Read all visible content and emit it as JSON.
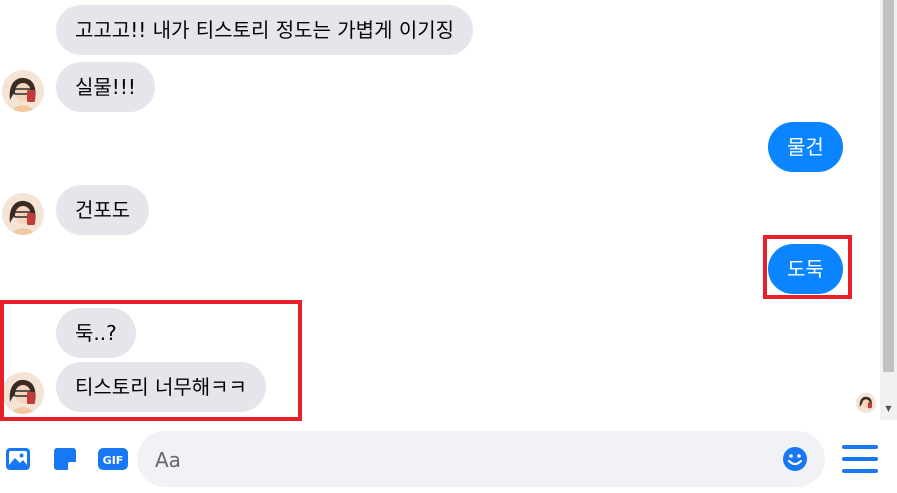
{
  "messages": [
    {
      "direction": "incoming",
      "text": "고고고!! 내가 티스토리 정도는 가볍게 이기징"
    },
    {
      "direction": "incoming",
      "text": "실물!!!"
    },
    {
      "direction": "outgoing",
      "text": "물건"
    },
    {
      "direction": "incoming",
      "text": "건포도"
    },
    {
      "direction": "outgoing",
      "text": "도둑"
    },
    {
      "direction": "incoming",
      "text": "둑..?"
    },
    {
      "direction": "incoming",
      "text": "티스토리 너무해ㅋㅋ"
    }
  ],
  "composer": {
    "placeholder": "Aa",
    "gif_label": "GIF"
  },
  "colors": {
    "outgoing_bubble": "#0a84ff",
    "incoming_bubble": "#e4e6eb",
    "icon_accent": "#1877f2",
    "highlight_box": "#e8202a"
  },
  "icons": [
    "photo-icon",
    "sticker-icon",
    "gif-icon",
    "emoji-icon",
    "menu-icon"
  ]
}
